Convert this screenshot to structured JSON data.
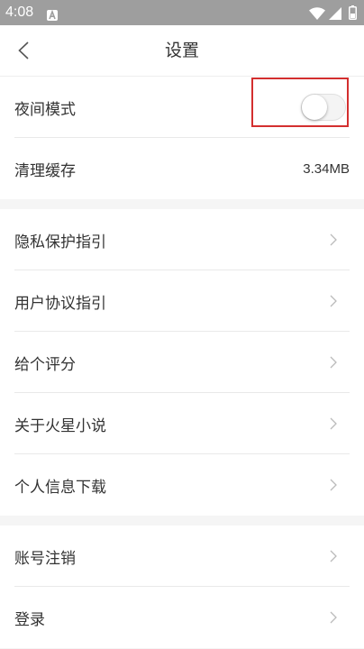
{
  "status_bar": {
    "time": "4:08",
    "icons": [
      "a-notification-icon",
      "wifi-icon",
      "signal-icon",
      "battery-icon"
    ]
  },
  "header": {
    "title": "设置",
    "back_icon": "chevron-left-icon"
  },
  "sections": [
    {
      "items": [
        {
          "label": "夜间模式",
          "toggle": {
            "on": false
          }
        },
        {
          "label": "清理缓存",
          "value": "3.34MB"
        }
      ]
    },
    {
      "items": [
        {
          "label": "隐私保护指引",
          "icon": "chevron-right-icon"
        },
        {
          "label": "用户协议指引",
          "icon": "chevron-right-icon"
        },
        {
          "label": "给个评分",
          "icon": "chevron-right-icon"
        },
        {
          "label": "关于火星小说",
          "icon": "chevron-right-icon"
        },
        {
          "label": "个人信息下载",
          "icon": "chevron-right-icon"
        }
      ]
    },
    {
      "items": [
        {
          "label": "账号注销",
          "icon": "chevron-right-icon"
        },
        {
          "label": "登录",
          "icon": "chevron-right-icon"
        }
      ]
    }
  ],
  "colors": {
    "status_bar": "#9e9e9e",
    "text": "#333333",
    "section_gap": "#f5f5f5",
    "divider": "#e9e9e9",
    "chevron": "#bbbbbb",
    "highlight": "#d32f2f"
  }
}
